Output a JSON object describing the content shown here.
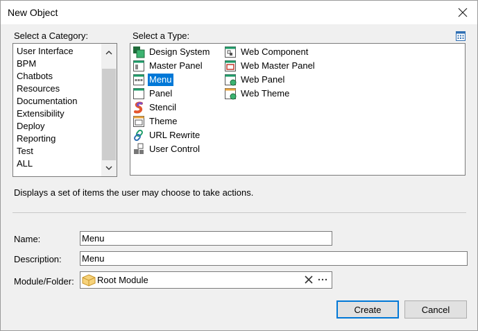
{
  "window": {
    "title": "New Object"
  },
  "category": {
    "label": "Select a Category:",
    "items": [
      "User Interface",
      "BPM",
      "Chatbots",
      "Resources",
      "Documentation",
      "Extensibility",
      "Deploy",
      "Reporting",
      "Test",
      "ALL"
    ]
  },
  "type": {
    "label": "Select a Type:",
    "items": [
      {
        "label": "Design System",
        "icon": "design-system-icon"
      },
      {
        "label": "Master Panel",
        "icon": "master-panel-icon"
      },
      {
        "label": "Menu",
        "icon": "menu-icon",
        "selected": true
      },
      {
        "label": "Panel",
        "icon": "panel-icon"
      },
      {
        "label": "Stencil",
        "icon": "stencil-icon"
      },
      {
        "label": "Theme",
        "icon": "theme-icon"
      },
      {
        "label": "URL Rewrite",
        "icon": "url-rewrite-icon"
      },
      {
        "label": "User Control",
        "icon": "user-control-icon"
      },
      {
        "label": "Web Component",
        "icon": "web-component-icon"
      },
      {
        "label": "Web Master Panel",
        "icon": "web-master-panel-icon"
      },
      {
        "label": "Web Panel",
        "icon": "web-panel-icon"
      },
      {
        "label": "Web Theme",
        "icon": "web-theme-icon"
      }
    ]
  },
  "description_text": "Displays a set of items the user may choose to take actions.",
  "form": {
    "name_label": "Name:",
    "name_value": "Menu",
    "description_label": "Description:",
    "description_value": "Menu",
    "module_label": "Module/Folder:",
    "module_value": "Root Module"
  },
  "buttons": {
    "create": "Create",
    "cancel": "Cancel"
  },
  "colors": {
    "selection": "#0078d7",
    "accent_green": "#1e9e6a"
  }
}
